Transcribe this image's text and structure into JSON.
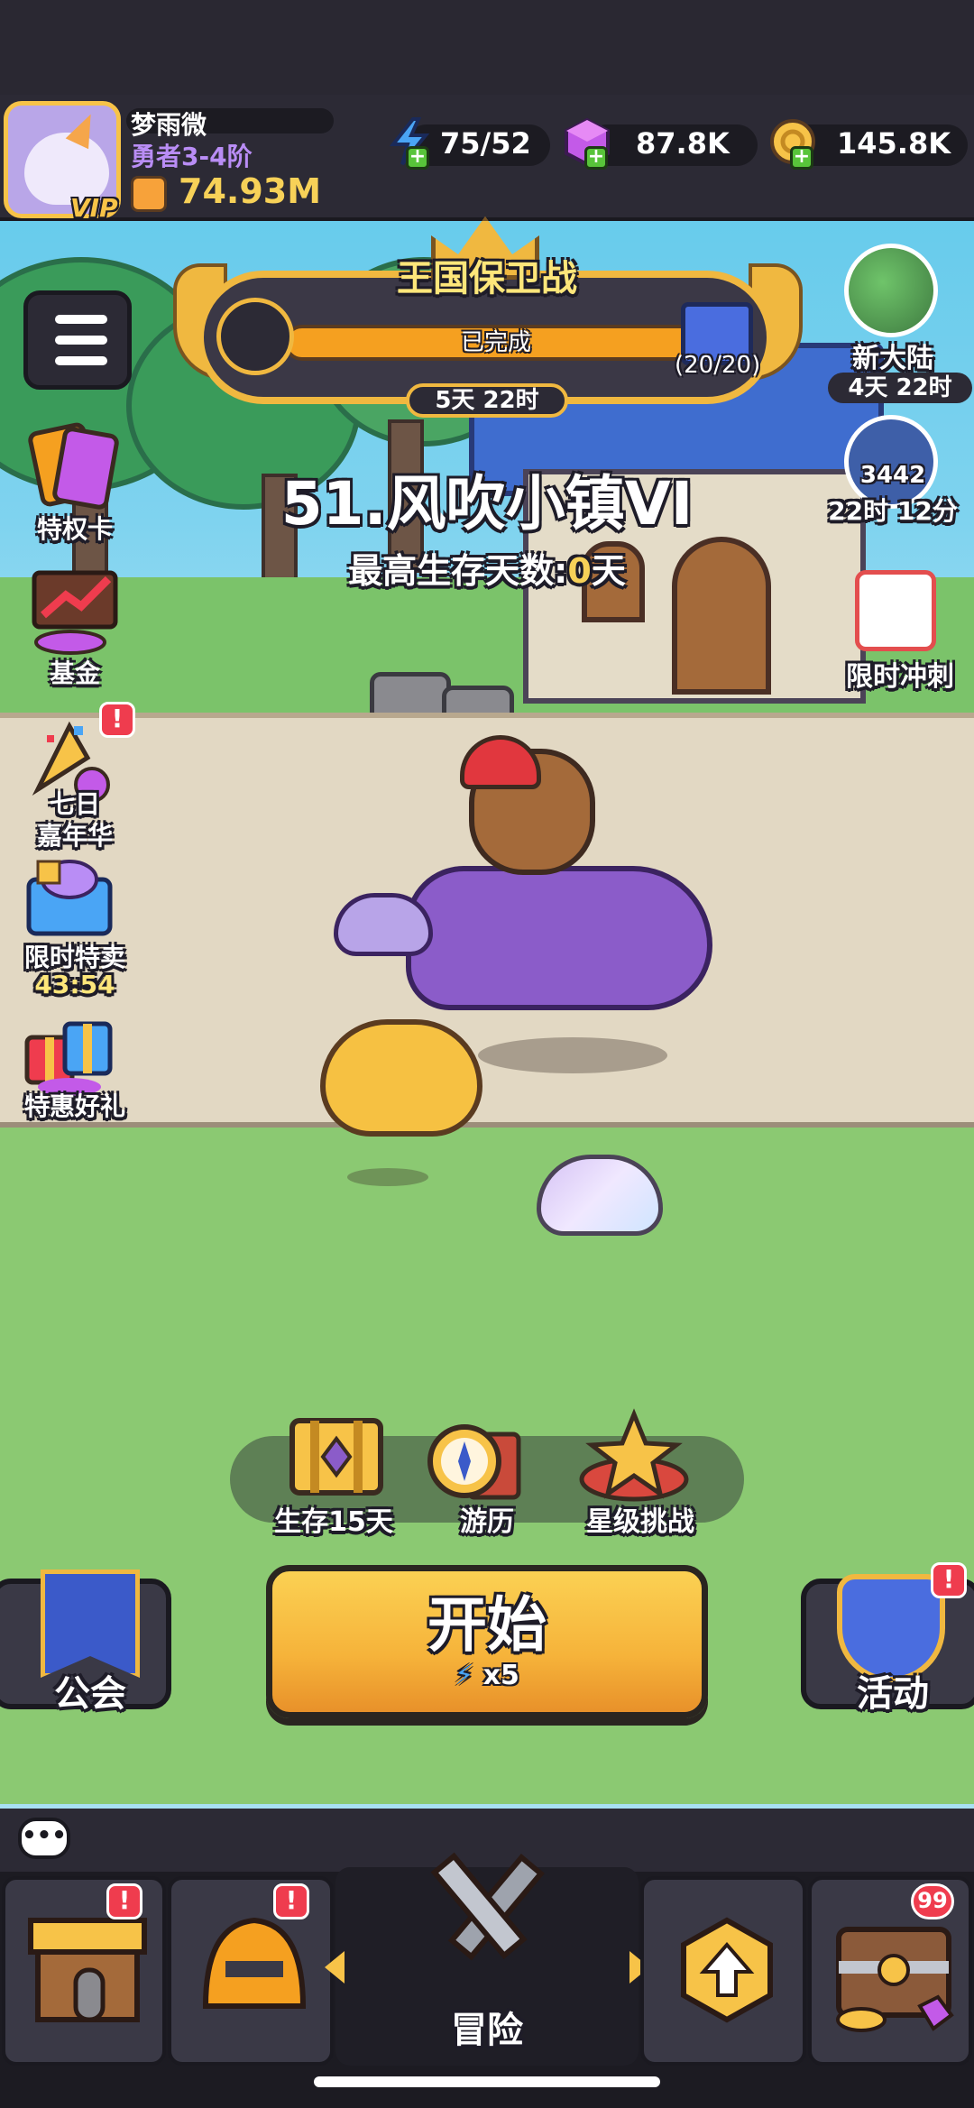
{
  "player": {
    "name": "梦雨微",
    "rank": "勇者3-4阶",
    "vip": "VIP",
    "power": "74.93M"
  },
  "resources": {
    "energy": "75/52",
    "gems": "87.8K",
    "gold": "145.8K"
  },
  "event_banner": {
    "title": "王国保卫战",
    "progress_label": "已完成",
    "gift_count": "(20/20)",
    "timer": "5天 22时"
  },
  "stage": {
    "name": "51.风吹小镇VI",
    "best_label": "最高生存天数:",
    "best_value": "0",
    "best_unit": "天"
  },
  "left_side": {
    "privilege_card": "特权卡",
    "fund": "基金",
    "seven_day_line1": "七日",
    "seven_day_line2": "嘉年华",
    "limited_sale": "限时特卖",
    "limited_sale_timer": "43:54",
    "special_gift": "特惠好礼",
    "badge": "!"
  },
  "right_side": {
    "new_continent": "新大陆",
    "new_continent_timer": "4天 22时",
    "tower_count": "3442",
    "tower_timer": "22时 12分",
    "rush": "限时冲刺"
  },
  "modes": {
    "survive": "生存15天",
    "travel": "游历",
    "star_challenge": "星级挑战"
  },
  "start": {
    "label": "开始",
    "cost": "x5"
  },
  "guild": {
    "label": "公会"
  },
  "events": {
    "label": "活动",
    "badge": "!"
  },
  "chat": {
    "icon": "•••"
  },
  "bottom_nav": {
    "shop_badge": "!",
    "equipment_badge": "!",
    "adventure": "冒险",
    "chest_badge": "99"
  },
  "colors": {
    "accent_gold": "#f0b840",
    "start_orange": "#f6b33a",
    "badge_red": "#ef3c4e",
    "sky": "#7fd3ef"
  }
}
